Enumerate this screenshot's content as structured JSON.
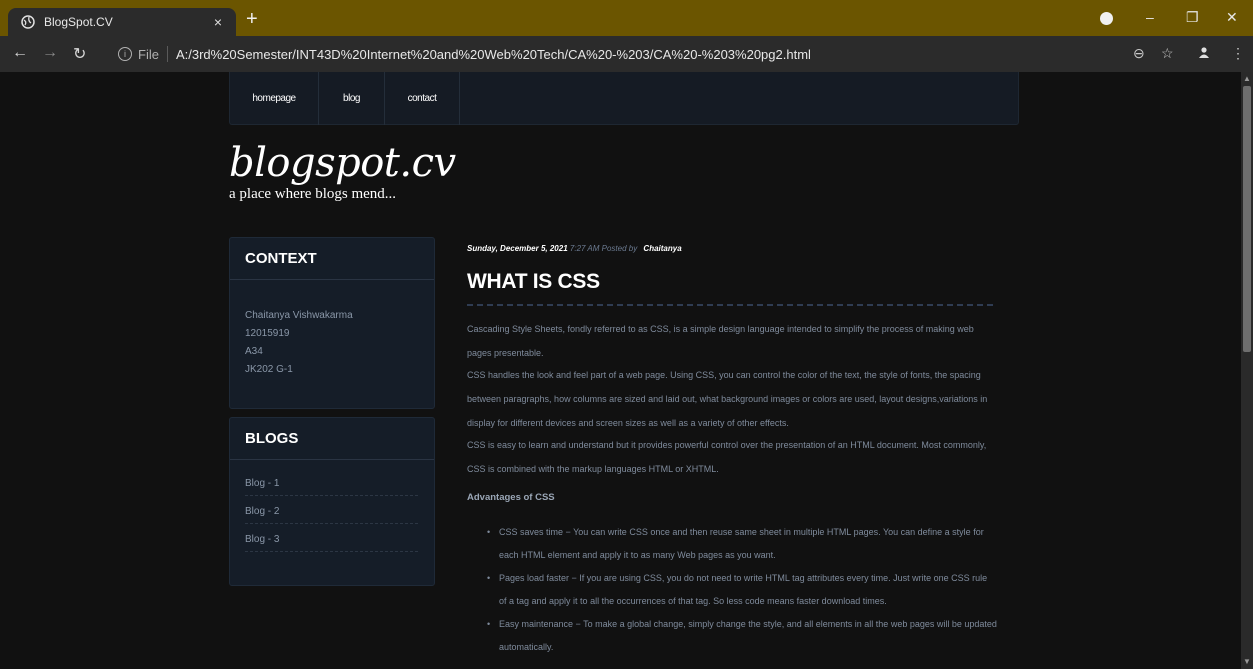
{
  "browser": {
    "tab_title": "BlogSpot.CV",
    "tab_close": "×",
    "new_tab": "+",
    "file_label": "File",
    "url": "A:/3rd%20Semester/INT43D%20Internet%20and%20Web%20Tech/CA%20-%203/CA%20-%203%20pg2.html",
    "icons": [
      "globe-icon",
      "close-icon",
      "plus-icon",
      "back-icon",
      "forward-icon",
      "reload-icon",
      "info-icon",
      "zoom-icon",
      "star-icon",
      "profile-icon",
      "menu-icon",
      "minimize-icon",
      "restore-icon",
      "window-close-icon"
    ]
  },
  "colors": {
    "tab_strip": "#6b5500",
    "page_background": "#111111",
    "panel": "#151d28",
    "body_text": "#7f8b9c"
  },
  "nav": {
    "items": [
      {
        "label": "homepage"
      },
      {
        "label": "blog"
      },
      {
        "label": "contact"
      }
    ]
  },
  "site": {
    "title": "blogspot.cv",
    "tagline": "a place where blogs mend..."
  },
  "sidebar": {
    "context": {
      "heading": "CONTEXT",
      "lines": [
        "Chaitanya Vishwakarma",
        "12015919",
        "A34",
        "JK202 G-1"
      ]
    },
    "blogs": {
      "heading": "BLOGS",
      "links": [
        "Blog - 1",
        "Blog - 2",
        "Blog - 3"
      ]
    }
  },
  "post": {
    "date": "Sunday, December 5, 2021",
    "time_posted_by": "7:27 AM Posted by",
    "author": "Chaitanya",
    "title": "WHAT IS CSS",
    "paragraphs": [
      "Cascading Style Sheets, fondly referred to as CSS, is a simple design language intended to simplify the process of making web pages presentable.",
      "CSS handles the look and feel part of a web page. Using CSS, you can control the color of the text, the style of fonts, the spacing between paragraphs, how columns are sized and laid out, what background images or colors are used, layout designs,variations in display for different devices and screen sizes as well as a variety of other effects.",
      "CSS is easy to learn and understand but it provides powerful control over the presentation of an HTML document. Most commonly, CSS is combined with the markup languages HTML or XHTML."
    ],
    "advantages_heading": "Advantages of CSS",
    "bullets": [
      "CSS saves time − You can write CSS once and then reuse same sheet in multiple HTML pages. You can define a style for each HTML element and apply it to as many Web pages as you want.",
      "Pages load faster − If you are using CSS, you do not need to write HTML tag attributes every time. Just write one CSS rule of a tag and apply it to all the occurrences of that tag. So less code means faster download times.",
      "Easy maintenance − To make a global change, simply change the style, and all elements in all the web pages will be updated automatically."
    ]
  }
}
